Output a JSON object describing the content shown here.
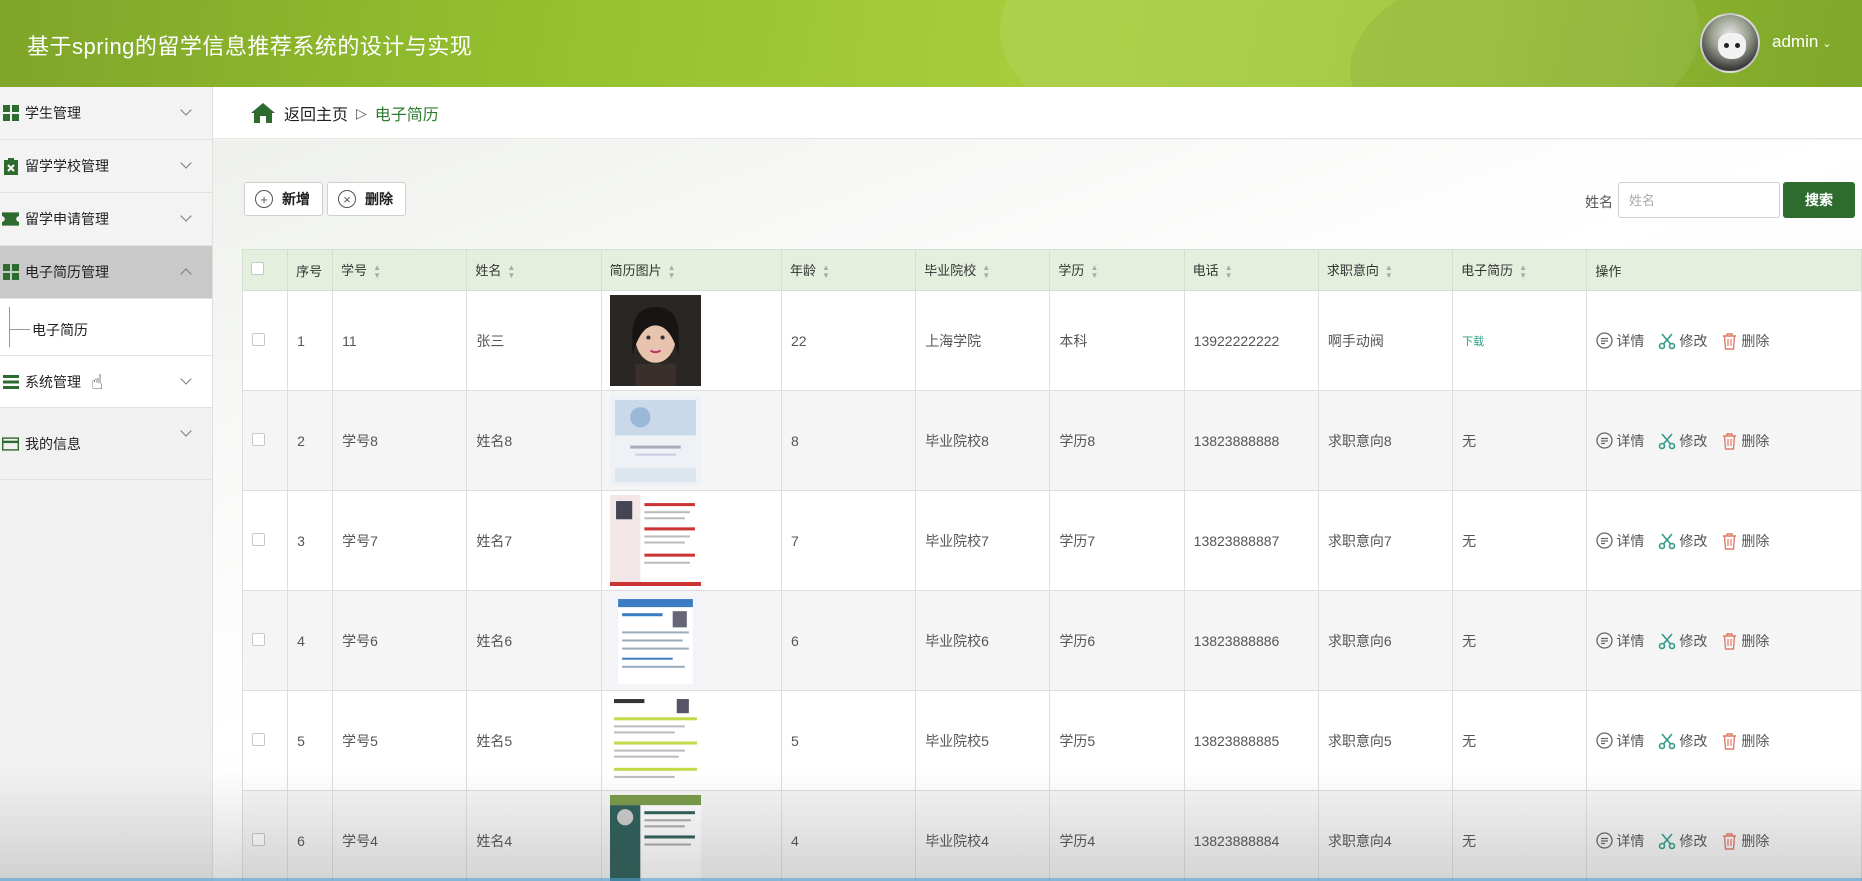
{
  "app": {
    "title": "基于spring的留学信息推荐系统的设计与实现",
    "user": "admin"
  },
  "sidebar": {
    "items": [
      {
        "label": "学生管理",
        "icon": "grid-icon"
      },
      {
        "label": "留学学校管理",
        "icon": "clipboard-icon"
      },
      {
        "label": "留学申请管理",
        "icon": "ticket-icon"
      },
      {
        "label": "电子简历管理",
        "icon": "grid-icon",
        "expanded": true,
        "children": [
          {
            "label": "电子简历"
          }
        ]
      },
      {
        "label": "系统管理",
        "icon": "list-icon"
      },
      {
        "label": "我的信息",
        "icon": "card-icon"
      }
    ]
  },
  "breadcrumb": {
    "home": "返回主页",
    "separator": "▷",
    "current": "电子简历"
  },
  "toolbar": {
    "add_label": "新增",
    "delete_label": "删除"
  },
  "search": {
    "label": "姓名",
    "placeholder": "姓名",
    "value": "",
    "button": "搜索"
  },
  "table": {
    "columns": [
      "序号",
      "学号",
      "姓名",
      "简历图片",
      "年龄",
      "毕业院校",
      "学历",
      "电话",
      "求职意向",
      "电子简历",
      "操作"
    ],
    "rows": [
      {
        "index": "1",
        "student_no": "11",
        "name": "张三",
        "age": "22",
        "school": "上海学院",
        "degree": "本科",
        "phone": "13922222222",
        "intention": "啊手动阀",
        "resume": "下载"
      },
      {
        "index": "2",
        "student_no": "学号8",
        "name": "姓名8",
        "age": "8",
        "school": "毕业院校8",
        "degree": "学历8",
        "phone": "13823888888",
        "intention": "求职意向8",
        "resume": "无"
      },
      {
        "index": "3",
        "student_no": "学号7",
        "name": "姓名7",
        "age": "7",
        "school": "毕业院校7",
        "degree": "学历7",
        "phone": "13823888887",
        "intention": "求职意向7",
        "resume": "无"
      },
      {
        "index": "4",
        "student_no": "学号6",
        "name": "姓名6",
        "age": "6",
        "school": "毕业院校6",
        "degree": "学历6",
        "phone": "13823888886",
        "intention": "求职意向6",
        "resume": "无"
      },
      {
        "index": "5",
        "student_no": "学号5",
        "name": "姓名5",
        "age": "5",
        "school": "毕业院校5",
        "degree": "学历5",
        "phone": "13823888885",
        "intention": "求职意向5",
        "resume": "无"
      },
      {
        "index": "6",
        "student_no": "学号4",
        "name": "姓名4",
        "age": "4",
        "school": "毕业院校4",
        "degree": "学历4",
        "phone": "13823888884",
        "intention": "求职意向4",
        "resume": "无"
      }
    ],
    "actions": {
      "detail": "详情",
      "edit": "修改",
      "delete": "删除"
    }
  },
  "colors": {
    "header_green": "#95c12f",
    "accent_green": "#2e6b2f",
    "table_header": "#e4f0dd",
    "link_teal": "#2e9e8a",
    "delete_red": "#d9534f"
  }
}
